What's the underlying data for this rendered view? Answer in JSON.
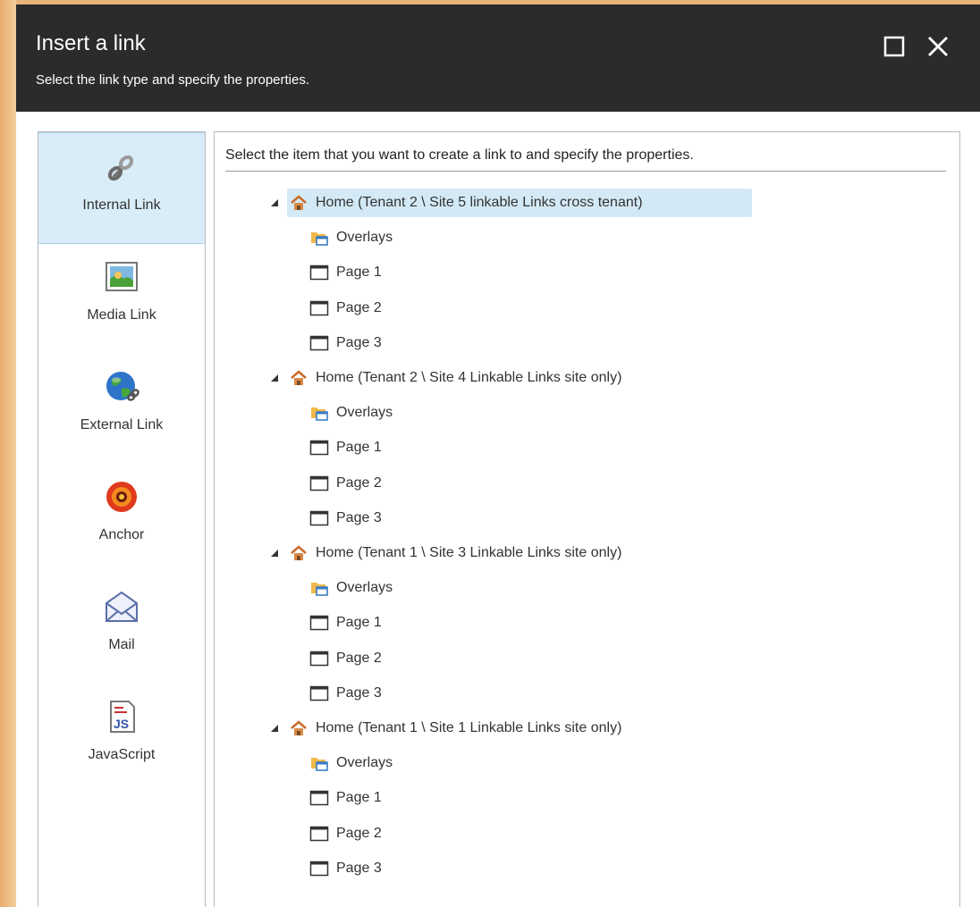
{
  "dialog": {
    "title": "Insert a link",
    "subtitle": "Select the link type and specify the properties."
  },
  "link_types": [
    {
      "label": "Internal Link",
      "icon": "chain-link-icon",
      "active": true
    },
    {
      "label": "Media Link",
      "icon": "image-icon",
      "active": false
    },
    {
      "label": "External Link",
      "icon": "globe-link-icon",
      "active": false
    },
    {
      "label": "Anchor",
      "icon": "target-icon",
      "active": false
    },
    {
      "label": "Mail",
      "icon": "envelope-icon",
      "active": false
    },
    {
      "label": "JavaScript",
      "icon": "javascript-file-icon",
      "active": false
    }
  ],
  "main": {
    "instructions": "Select the item that you want to create a link to and specify the properties."
  },
  "tree": [
    {
      "label": "Home (Tenant 2 \\ Site 5 linkable Links cross tenant)",
      "selected": true,
      "children": [
        "Overlays",
        "Page 1",
        "Page 2",
        "Page 3"
      ]
    },
    {
      "label": "Home (Tenant 2 \\ Site 4 Linkable Links site only)",
      "selected": false,
      "children": [
        "Overlays",
        "Page 1",
        "Page 2",
        "Page 3"
      ]
    },
    {
      "label": "Home (Tenant 1 \\ Site 3 Linkable Links site only)",
      "selected": false,
      "children": [
        "Overlays",
        "Page 1",
        "Page 2",
        "Page 3"
      ]
    },
    {
      "label": "Home (Tenant 1 \\ Site 1 Linkable Links site only)",
      "selected": false,
      "children": [
        "Overlays",
        "Page 1",
        "Page 2",
        "Page 3"
      ]
    }
  ]
}
